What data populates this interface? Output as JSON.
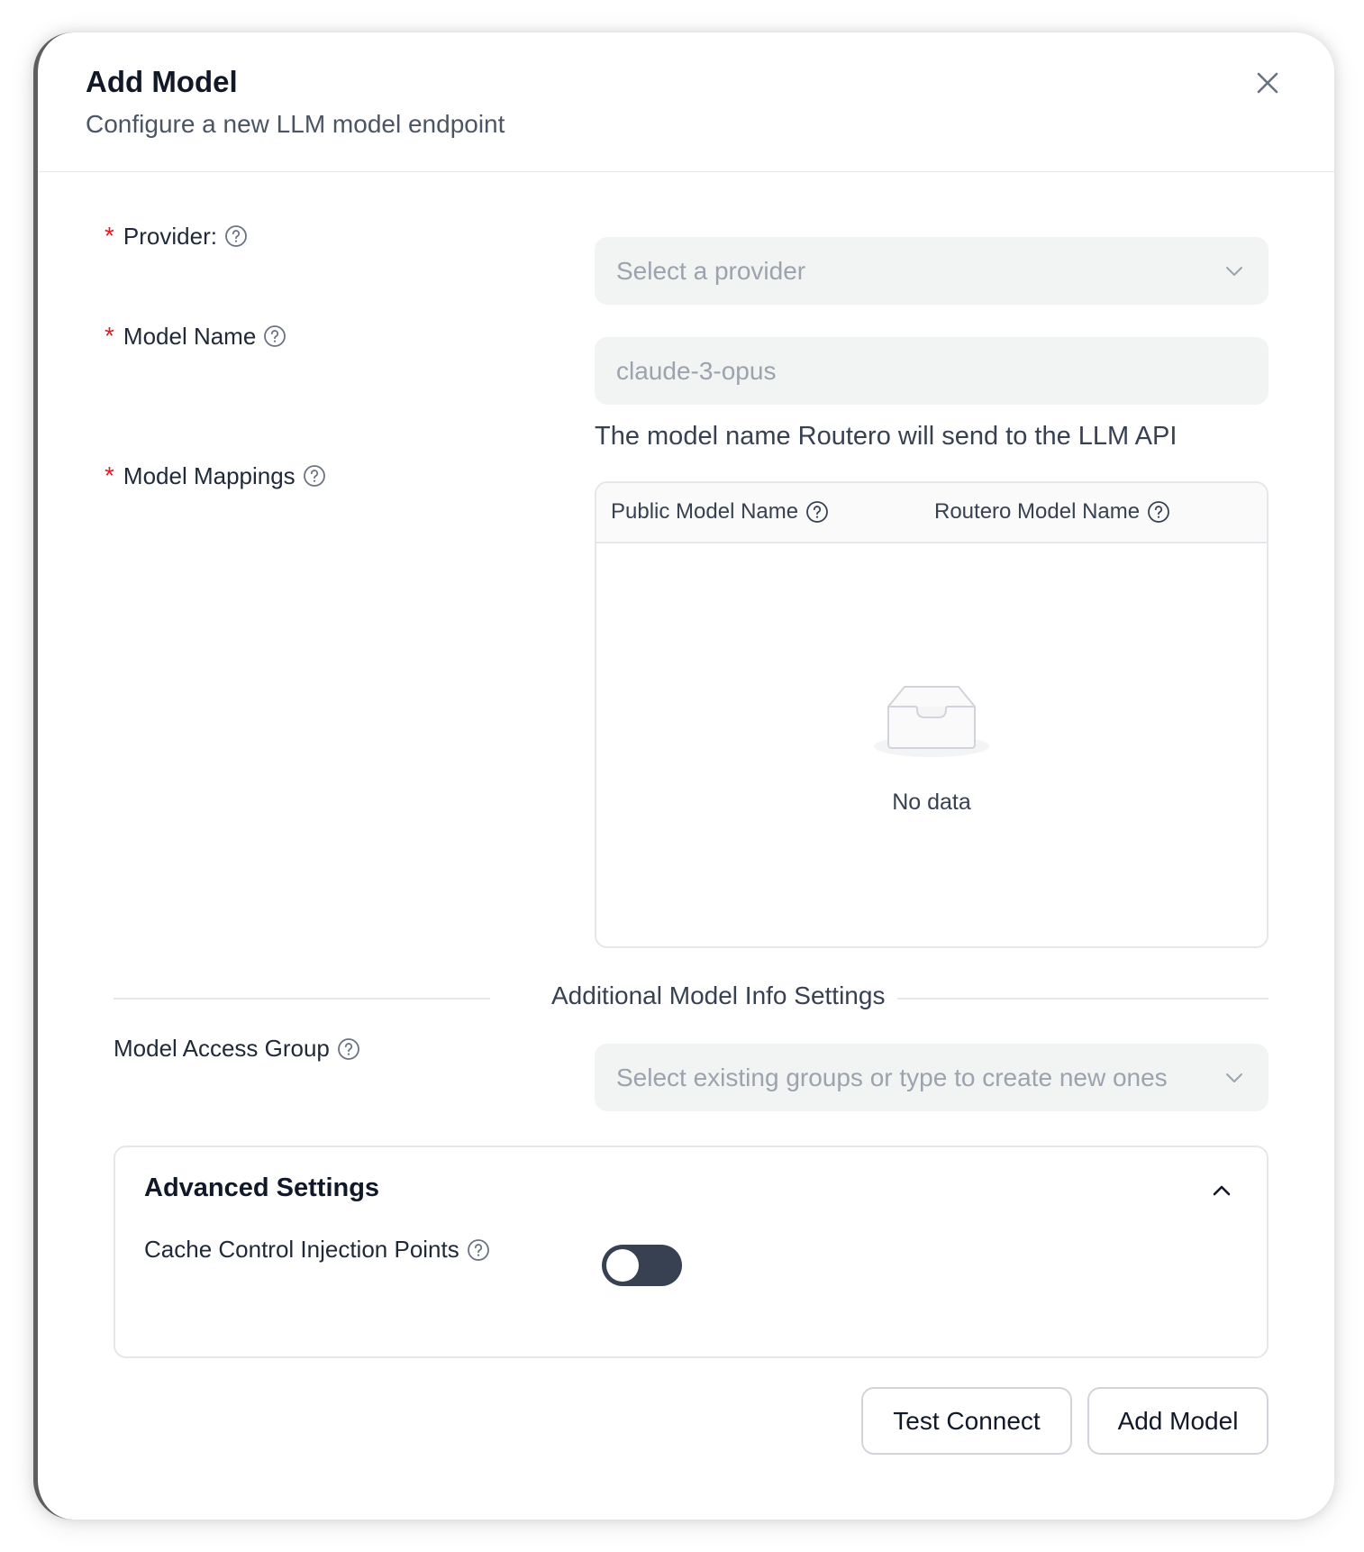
{
  "dialog": {
    "title": "Add Model",
    "subtitle": "Configure a new LLM model endpoint"
  },
  "form": {
    "required_mark": "*",
    "provider": {
      "label": "Provider:",
      "placeholder": "Select a provider"
    },
    "model_name": {
      "label": "Model Name",
      "placeholder": "claude-3-opus",
      "hint": "The model name Routero will send to the LLM API"
    },
    "model_mappings": {
      "label": "Model Mappings",
      "columns": [
        "Public Model Name",
        "Routero Model Name"
      ],
      "empty_text": "No data"
    },
    "section_divider": "Additional Model Info Settings",
    "model_access_group": {
      "label": "Model Access Group",
      "placeholder": "Select existing groups or type to create new ones"
    },
    "advanced": {
      "title": "Advanced Settings",
      "cache_control_label": "Cache Control Injection Points",
      "cache_control_enabled": false
    }
  },
  "footer": {
    "test_button": "Test Connect",
    "submit_button": "Add Model"
  },
  "icons": {
    "close": "close-icon",
    "help": "question-circle-icon",
    "dropdown": "chevron-down-icon",
    "collapse": "chevron-up-icon",
    "empty": "empty-inbox-icon"
  },
  "colors": {
    "required": "#e11d29",
    "toggle_off": "#374151",
    "field_bg": "#f2f3f3"
  }
}
